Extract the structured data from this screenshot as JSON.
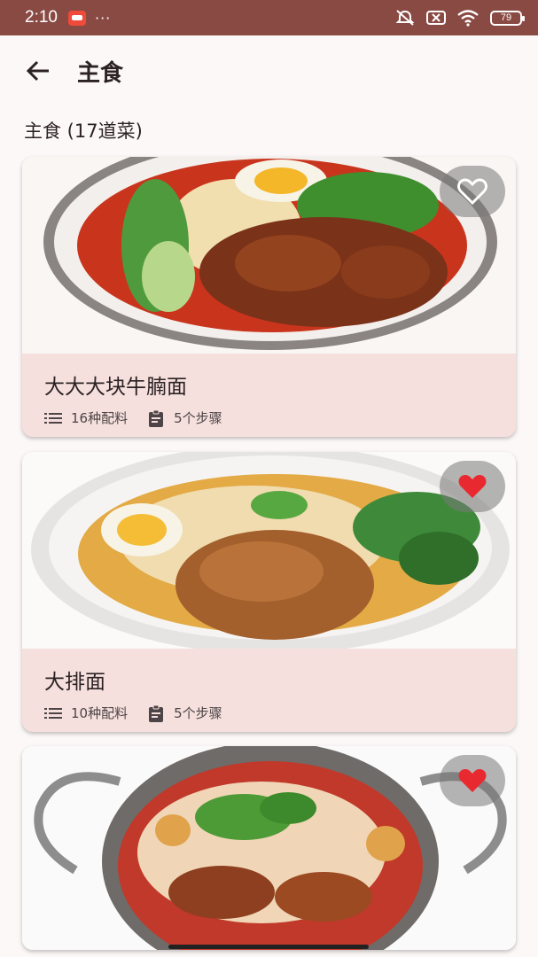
{
  "status_bar": {
    "time": "2:10",
    "more": "···",
    "battery_level": "79",
    "icons": [
      "app-notification-icon",
      "mute-icon",
      "sim-off-icon",
      "wifi-icon",
      "battery-icon"
    ]
  },
  "app_bar": {
    "back_icon": "arrow-left-icon",
    "title": "主食"
  },
  "section": {
    "title": "主食 (17道菜)"
  },
  "recipes": [
    {
      "name": "大大大块牛腩面",
      "ingredients": "16种配料",
      "steps": "5个步骤",
      "favorited": false,
      "image": "beef-brisket-noodle-soup"
    },
    {
      "name": "大排面",
      "ingredients": "10种配料",
      "steps": "5个步骤",
      "favorited": true,
      "image": "pork-chop-noodle-soup"
    },
    {
      "name": "",
      "favorited": true,
      "image": "spicy-big-plate-noodles"
    }
  ],
  "colors": {
    "status_bar": "#8a4a44",
    "card_body": "#f6e0dd",
    "heart_active": "#e8292f",
    "background": "#fdf8f8"
  }
}
